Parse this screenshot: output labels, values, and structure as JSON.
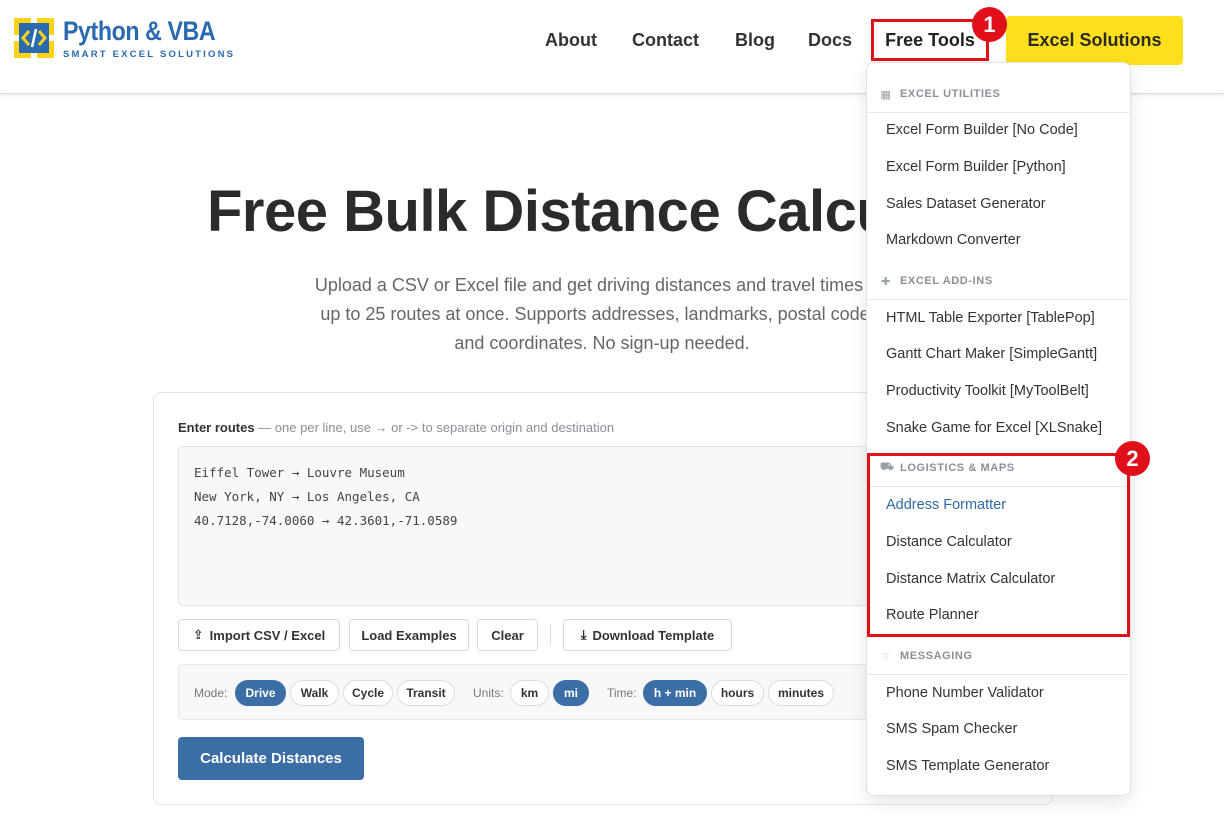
{
  "brand": {
    "name": "Python & VBA",
    "tagline": "SMART EXCEL SOLUTIONS",
    "colors": {
      "primary": "#2a6ab0",
      "accent": "#ffe01a",
      "highlight": "#e0101a"
    }
  },
  "nav": {
    "about": "About",
    "contact": "Contact",
    "blog": "Blog",
    "docs": "Docs",
    "free_tools": "Free Tools",
    "cta": "Excel Solutions"
  },
  "annotations": {
    "badge1": "1",
    "badge2": "2"
  },
  "hero": {
    "title": "Free Bulk Distance Calcu",
    "subtitle": "Upload a CSV or Excel file and get driving distances and travel times for up to 25 routes at once. Supports addresses, landmarks, postal codes, and coordinates. No sign-up needed."
  },
  "tool": {
    "routes_label": "Enter routes",
    "routes_hint": " — one per line, use → or -> to separate origin and destination",
    "routes": [
      "Eiffel Tower → Louvre Museum",
      "New York, NY → Los Angeles, CA",
      "40.7128,-74.0060 → 42.3601,-71.0589"
    ],
    "buttons": {
      "import": "Import CSV / Excel",
      "examples": "Load Examples",
      "clear": "Clear",
      "template": "Download Template"
    },
    "mode_label": "Mode:",
    "modes": [
      "Drive",
      "Walk",
      "Cycle",
      "Transit"
    ],
    "mode_selected": "Drive",
    "units_label": "Units:",
    "units": [
      "km",
      "mi"
    ],
    "units_selected": "mi",
    "time_label": "Time:",
    "times": [
      "h + min",
      "hours",
      "minutes"
    ],
    "time_selected": "h + min",
    "calculate": "Calculate Distances"
  },
  "dropdown": {
    "sections": [
      {
        "title": "EXCEL UTILITIES",
        "icon": "table-icon",
        "items": [
          "Excel Form Builder [No Code]",
          "Excel Form Builder [Python]",
          "Sales Dataset Generator",
          "Markdown Converter"
        ]
      },
      {
        "title": "EXCEL ADD-INS",
        "icon": "puzzle-icon",
        "items": [
          "HTML Table Exporter [TablePop]",
          "Gantt Chart Maker [SimpleGantt]",
          "Productivity Toolkit [MyToolBelt]",
          "Snake Game for Excel [XLSnake]"
        ]
      },
      {
        "title": "LOGISTICS & MAPS",
        "icon": "truck-icon",
        "items": [
          "Address Formatter",
          "Distance Calculator",
          "Distance Matrix Calculator",
          "Route Planner"
        ]
      },
      {
        "title": "MESSAGING",
        "icon": "chat-icon",
        "items": [
          "Phone Number Validator",
          "SMS Spam Checker",
          "SMS Template Generator"
        ]
      }
    ]
  }
}
